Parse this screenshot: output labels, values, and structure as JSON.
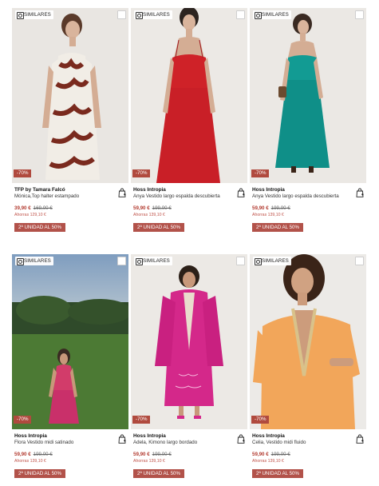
{
  "products": [
    {
      "similar_label": "SIMILARES",
      "discount": "-70%",
      "brand": "TFP by Tamara Falcó",
      "name": "Mónica,Top halter estampado",
      "price": "39,90 €",
      "old_price": "169,00 €",
      "saving": "Ahorras 129,10 €",
      "promo": "2ª UNIDAD AL 50%"
    },
    {
      "similar_label": "SIMILARES",
      "discount": "-70%",
      "brand": "Hoss Intropia",
      "name": "Anya Vestido largo espalda descubierta",
      "price": "59,90 €",
      "old_price": "199,00 €",
      "saving": "Ahorras 139,10 €",
      "promo": "2ª UNIDAD AL 50%"
    },
    {
      "similar_label": "SIMILARES",
      "discount": "-70%",
      "brand": "Hoss Intropia",
      "name": "Anya Vestido largo espalda descubierta",
      "price": "59,90 €",
      "old_price": "199,00 €",
      "saving": "Ahorras 139,10 €",
      "promo": "2ª UNIDAD AL 50%"
    },
    {
      "similar_label": "SIMILARES",
      "discount": "-70%",
      "brand": "Hoss Intropia",
      "name": "Flora Vestido midi satinado",
      "price": "59,90 €",
      "old_price": "199,00 €",
      "saving": "Ahorras 139,10 €",
      "promo": "2ª UNIDAD AL 50%"
    },
    {
      "similar_label": "SIMILARES",
      "discount": "-70%",
      "brand": "Hoss Intropia",
      "name": "Adela, Kimono largo bordado",
      "price": "59,90 €",
      "old_price": "199,00 €",
      "saving": "Ahorras 139,10 €",
      "promo": "2ª UNIDAD AL 50%"
    },
    {
      "similar_label": "SIMILARES",
      "discount": "-70%",
      "brand": "Hoss Intropia",
      "name": "Celia, Vestido midi fluido",
      "price": "59,90 €",
      "old_price": "199,00 €",
      "saving": "Ahorras 139,10 €",
      "promo": "2ª UNIDAD AL 50%"
    }
  ],
  "colors": {
    "discount_badge": "#b04a3e",
    "promo_badge": "#b2524a",
    "sale_price": "#b23a2f"
  }
}
